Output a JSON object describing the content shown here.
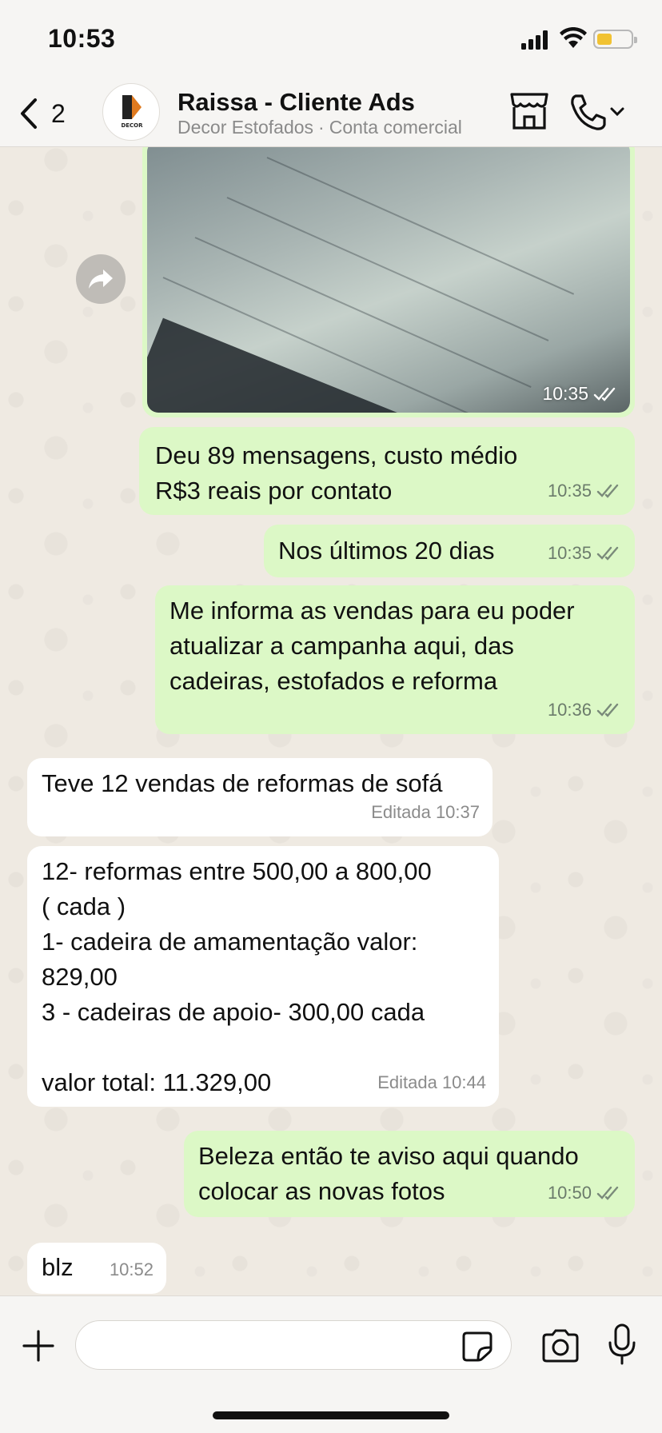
{
  "status_bar": {
    "time": "10:53"
  },
  "header": {
    "back_count": "2",
    "avatar_text": "DECOR",
    "contact_name": "Raissa - Cliente Ads",
    "subtitle_name": "Decor Estofados",
    "subtitle_type": "Conta comercial"
  },
  "image_message": {
    "time": "10:35"
  },
  "messages": [
    {
      "text": "Deu 89 mensagens, custo médio R$3 reais por contato",
      "time": "10:35"
    },
    {
      "text": "Nos últimos 20 dias",
      "time": "10:35"
    },
    {
      "text": "Me informa as vendas para eu poder atualizar a campanha aqui, das cadeiras, estofados e reforma",
      "time": "10:36"
    },
    {
      "text": "Teve 12 vendas de reformas de sofá",
      "time": "Editada 10:37"
    },
    {
      "line1": "12- reformas entre 500,00 a 800,00",
      "line2": "( cada )",
      "line3": "1- cadeira de amamentação valor:",
      "line4": "829,00",
      "line5": "3 - cadeiras de apoio- 300,00 cada",
      "line6": "valor total: 11.329,00",
      "time": "Editada 10:44"
    },
    {
      "text": "Beleza então te aviso aqui quando colocar as novas fotos",
      "time": "10:50"
    },
    {
      "text": "blz",
      "time": "10:52"
    }
  ],
  "colors": {
    "outgoing": "#dcf8c6",
    "incoming": "#ffffff",
    "read_ticks": "#7a8a7a"
  }
}
